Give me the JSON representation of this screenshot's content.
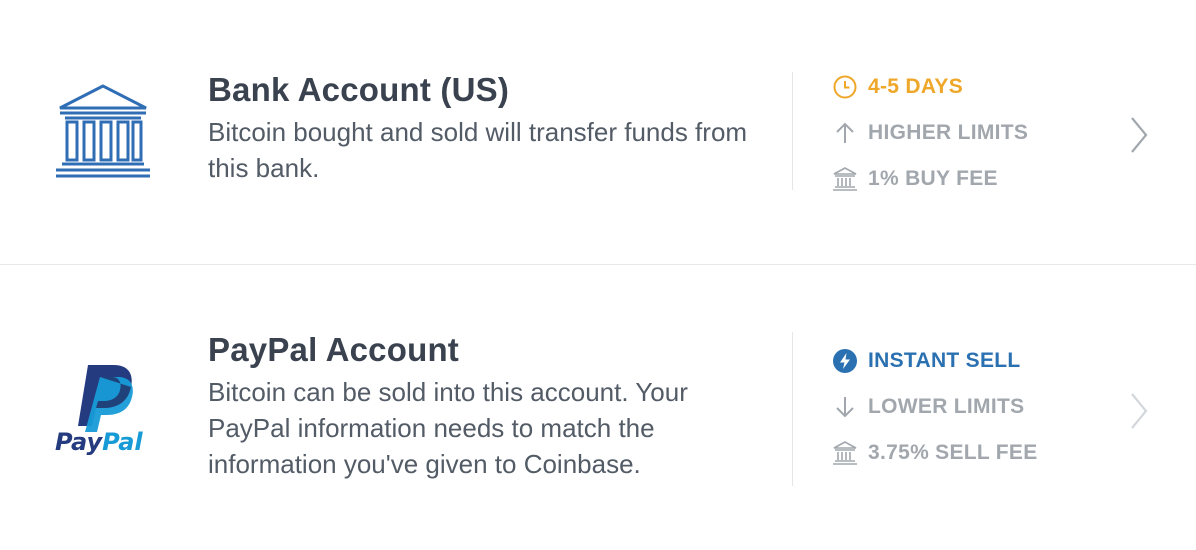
{
  "colors": {
    "title": "#39424e",
    "description": "#525b66",
    "muted": "#a1a7ad",
    "warning": "#efa72a",
    "accent": "#2b71b1",
    "bank_icon": "#2f6db5",
    "paypal_dark": "#253b80",
    "paypal_light": "#179bd7"
  },
  "accounts": [
    {
      "title": "Bank Account (US)",
      "description": "Bitcoin bought and sold will transfer funds from this bank.",
      "icon": "bank-icon",
      "features": [
        {
          "icon": "clock-icon",
          "label": "4-5 DAYS",
          "color": "#efa72a"
        },
        {
          "icon": "arrow-up-icon",
          "label": "HIGHER LIMITS",
          "color": "#a1a7ad"
        },
        {
          "icon": "bank-small-icon",
          "label": "1% BUY FEE",
          "color": "#a1a7ad"
        }
      ],
      "chevron": "chevron-right-icon"
    },
    {
      "title": "PayPal Account",
      "description": "Bitcoin can be sold into this account. Your PayPal information needs to match the information you've given to Coinbase.",
      "icon": "paypal-logo",
      "logo_text": "PayPal",
      "features": [
        {
          "icon": "lightning-icon",
          "label": "INSTANT SELL",
          "color": "#2b71b1"
        },
        {
          "icon": "arrow-down-icon",
          "label": "LOWER LIMITS",
          "color": "#a1a7ad"
        },
        {
          "icon": "bank-small-icon",
          "label": "3.75% SELL FEE",
          "color": "#a1a7ad"
        }
      ],
      "chevron": "chevron-right-icon"
    }
  ]
}
